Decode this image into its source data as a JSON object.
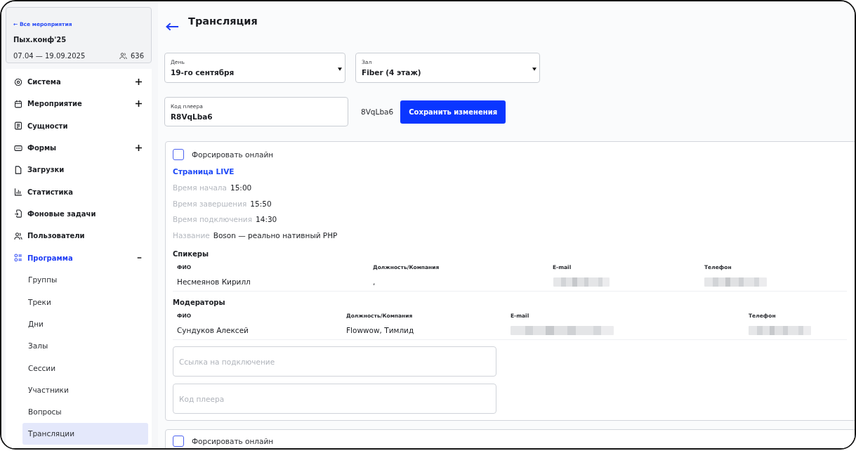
{
  "event_card": {
    "back_link": "← Все мероприятия",
    "title": "Пых.конф'25",
    "dates": "07.04 — 19.09.2025",
    "participants": "636"
  },
  "sidebar": {
    "items": [
      {
        "label": "Система",
        "kind": "group",
        "expanded": false,
        "selected": false
      },
      {
        "label": "Мероприятие",
        "kind": "group",
        "expanded": false,
        "selected": false
      },
      {
        "label": "Сущности",
        "kind": "link",
        "selected": false
      },
      {
        "label": "Формы",
        "kind": "group",
        "expanded": false,
        "selected": false
      },
      {
        "label": "Загрузки",
        "kind": "link",
        "selected": false
      },
      {
        "label": "Статистика",
        "kind": "link",
        "selected": false
      },
      {
        "label": "Фоновые задачи",
        "kind": "link",
        "selected": false
      },
      {
        "label": "Пользователи",
        "kind": "link",
        "selected": false
      },
      {
        "label": "Программа",
        "kind": "group",
        "expanded": true,
        "selected": true,
        "children": [
          {
            "label": "Группы",
            "selected": false
          },
          {
            "label": "Треки",
            "selected": false
          },
          {
            "label": "Дни",
            "selected": false
          },
          {
            "label": "Залы",
            "selected": false
          },
          {
            "label": "Сессии",
            "selected": false
          },
          {
            "label": "Участники",
            "selected": false
          },
          {
            "label": "Вопросы",
            "selected": false
          },
          {
            "label": "Трансляции",
            "selected": true
          }
        ]
      }
    ]
  },
  "page": {
    "title": "Трансляция"
  },
  "filters": [
    {
      "label": "День",
      "value": "19-го сентября"
    },
    {
      "label": "Зал",
      "value": "Fiber (4 этаж)"
    }
  ],
  "player_code": {
    "label": "Код плеера",
    "value": "R8VqLba6"
  },
  "player_code_preview": "8VqLba6",
  "save_button": "Сохранить изменения",
  "broadcasts": [
    {
      "force_online": {
        "label": "Форсировать онлайн",
        "checked": false
      },
      "live_link": "Страница LIVE",
      "details": [
        {
          "label": "Время начала",
          "value": "15:00"
        },
        {
          "label": "Время завершения",
          "value": "15:50"
        },
        {
          "label": "Время подключения",
          "value": "14:30"
        },
        {
          "label": "Название",
          "value": "Boson — реально нативный PHP"
        }
      ],
      "speakers": {
        "title": "Спикеры",
        "columns": [
          "ФИО",
          "Должность/Компания",
          "E-mail",
          "Телефон"
        ],
        "rows": [
          {
            "cells": [
              {
                "kind": "text",
                "text": "Несмеянов Кирилл"
              },
              {
                "kind": "text",
                "text": ","
              },
              {
                "kind": "redacted"
              },
              {
                "kind": "redacted"
              }
            ]
          }
        ]
      },
      "moderators": {
        "title": "Модераторы",
        "columns": [
          "ФИО",
          "Должность/Компания",
          "E-mail",
          "Телефон"
        ],
        "rows": [
          {
            "cells": [
              {
                "kind": "text",
                "text": "Сундуков Алексей"
              },
              {
                "kind": "text",
                "text": "Flowwow, Тимлид"
              },
              {
                "kind": "redacted"
              },
              {
                "kind": "redacted"
              }
            ]
          }
        ]
      },
      "fields": [
        {
          "placeholder": "Ссылка на подключение"
        },
        {
          "placeholder": "Код плеера"
        }
      ]
    },
    {
      "force_online": {
        "label": "Форсировать онлайн",
        "checked": false
      }
    }
  ]
}
